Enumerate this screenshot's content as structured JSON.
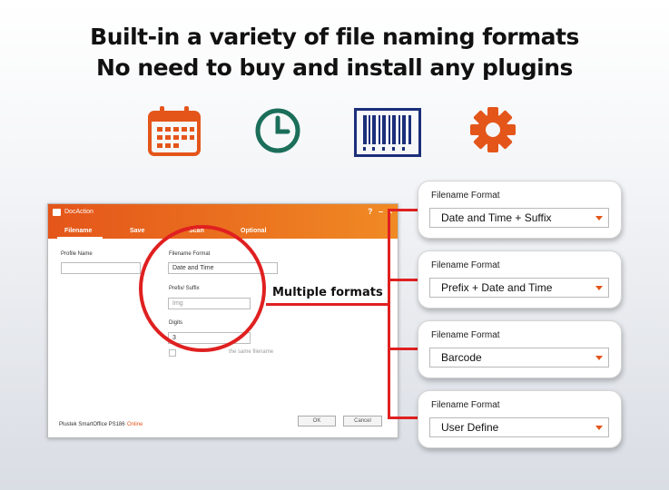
{
  "headline": {
    "line1": "Built-in a variety of file naming formats",
    "line2": "No need to buy and install any plugins"
  },
  "icons": [
    "calendar-icon",
    "clock-icon",
    "barcode-icon",
    "gear-icon"
  ],
  "colors": {
    "accent": "#e4551a",
    "clock": "#1b6e5a",
    "barcode": "#1b2f7a",
    "callout_line": "#e02020"
  },
  "window": {
    "title": "DocAction",
    "help": "?",
    "tabs": [
      "Filename",
      "Save",
      "Scan",
      "Optional"
    ],
    "profile_name_label": "Profile Name",
    "profile_name_value": "",
    "filename_format_label": "Filename Format",
    "filename_format_value": "Date and Time",
    "prefix_suffix_label": "Prefix/ Suffix",
    "prefix_suffix_placeholder": "Img",
    "digits_label": "Digits",
    "digits_value": "3",
    "overwrite_label": "the same filename",
    "device": "Plustek SmartOffice PS186",
    "status": "Online",
    "ok_label": "OK",
    "cancel_label": "Cancel"
  },
  "annotation": "Multiple formats",
  "callouts": [
    {
      "label": "Filename Format",
      "value": "Date and Time + Suffix"
    },
    {
      "label": "Filename Format",
      "value": "Prefix + Date and Time"
    },
    {
      "label": "Filename Format",
      "value": "Barcode"
    },
    {
      "label": "Filename Format",
      "value": "User Define"
    }
  ]
}
